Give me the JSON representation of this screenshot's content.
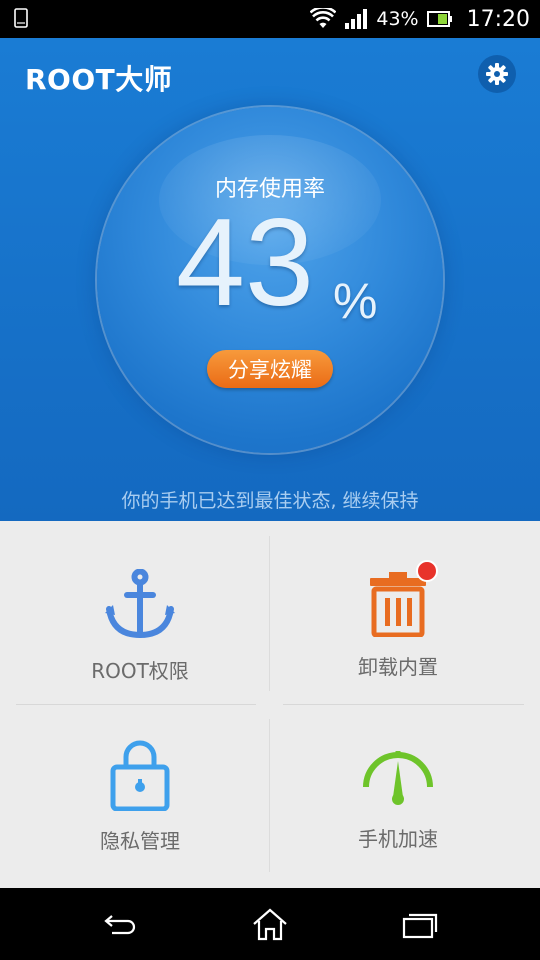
{
  "status_bar": {
    "battery_percent": "43%",
    "time": "17:20",
    "icons": [
      "phone-icon",
      "wifi-icon",
      "signal-icon",
      "battery-icon"
    ]
  },
  "header": {
    "app_title": "ROOT大师",
    "settings_icon": "gear-icon"
  },
  "memory": {
    "label": "内存使用率",
    "value": "43",
    "unit": "%",
    "share_button": "分享炫耀",
    "status_message": "你的手机已达到最佳状态, 继续保持"
  },
  "grid": {
    "items": [
      {
        "label": "ROOT权限",
        "icon": "anchor-icon",
        "color": "#4a86dd"
      },
      {
        "label": "卸载内置",
        "icon": "trash-icon",
        "color": "#e86c21",
        "badge": true
      },
      {
        "label": "隐私管理",
        "icon": "lock-icon",
        "color": "#3ea0ec"
      },
      {
        "label": "手机加速",
        "icon": "speedometer-icon",
        "color": "#6ec42a"
      }
    ]
  },
  "nav_bar": {
    "icons": [
      "back-icon",
      "home-icon",
      "recent-apps-icon"
    ]
  },
  "colors": {
    "hero_blue": "#1a7cd4",
    "share_orange": "#ef7a22",
    "grid_bg": "#ececec",
    "badge_red": "#e8332b"
  }
}
